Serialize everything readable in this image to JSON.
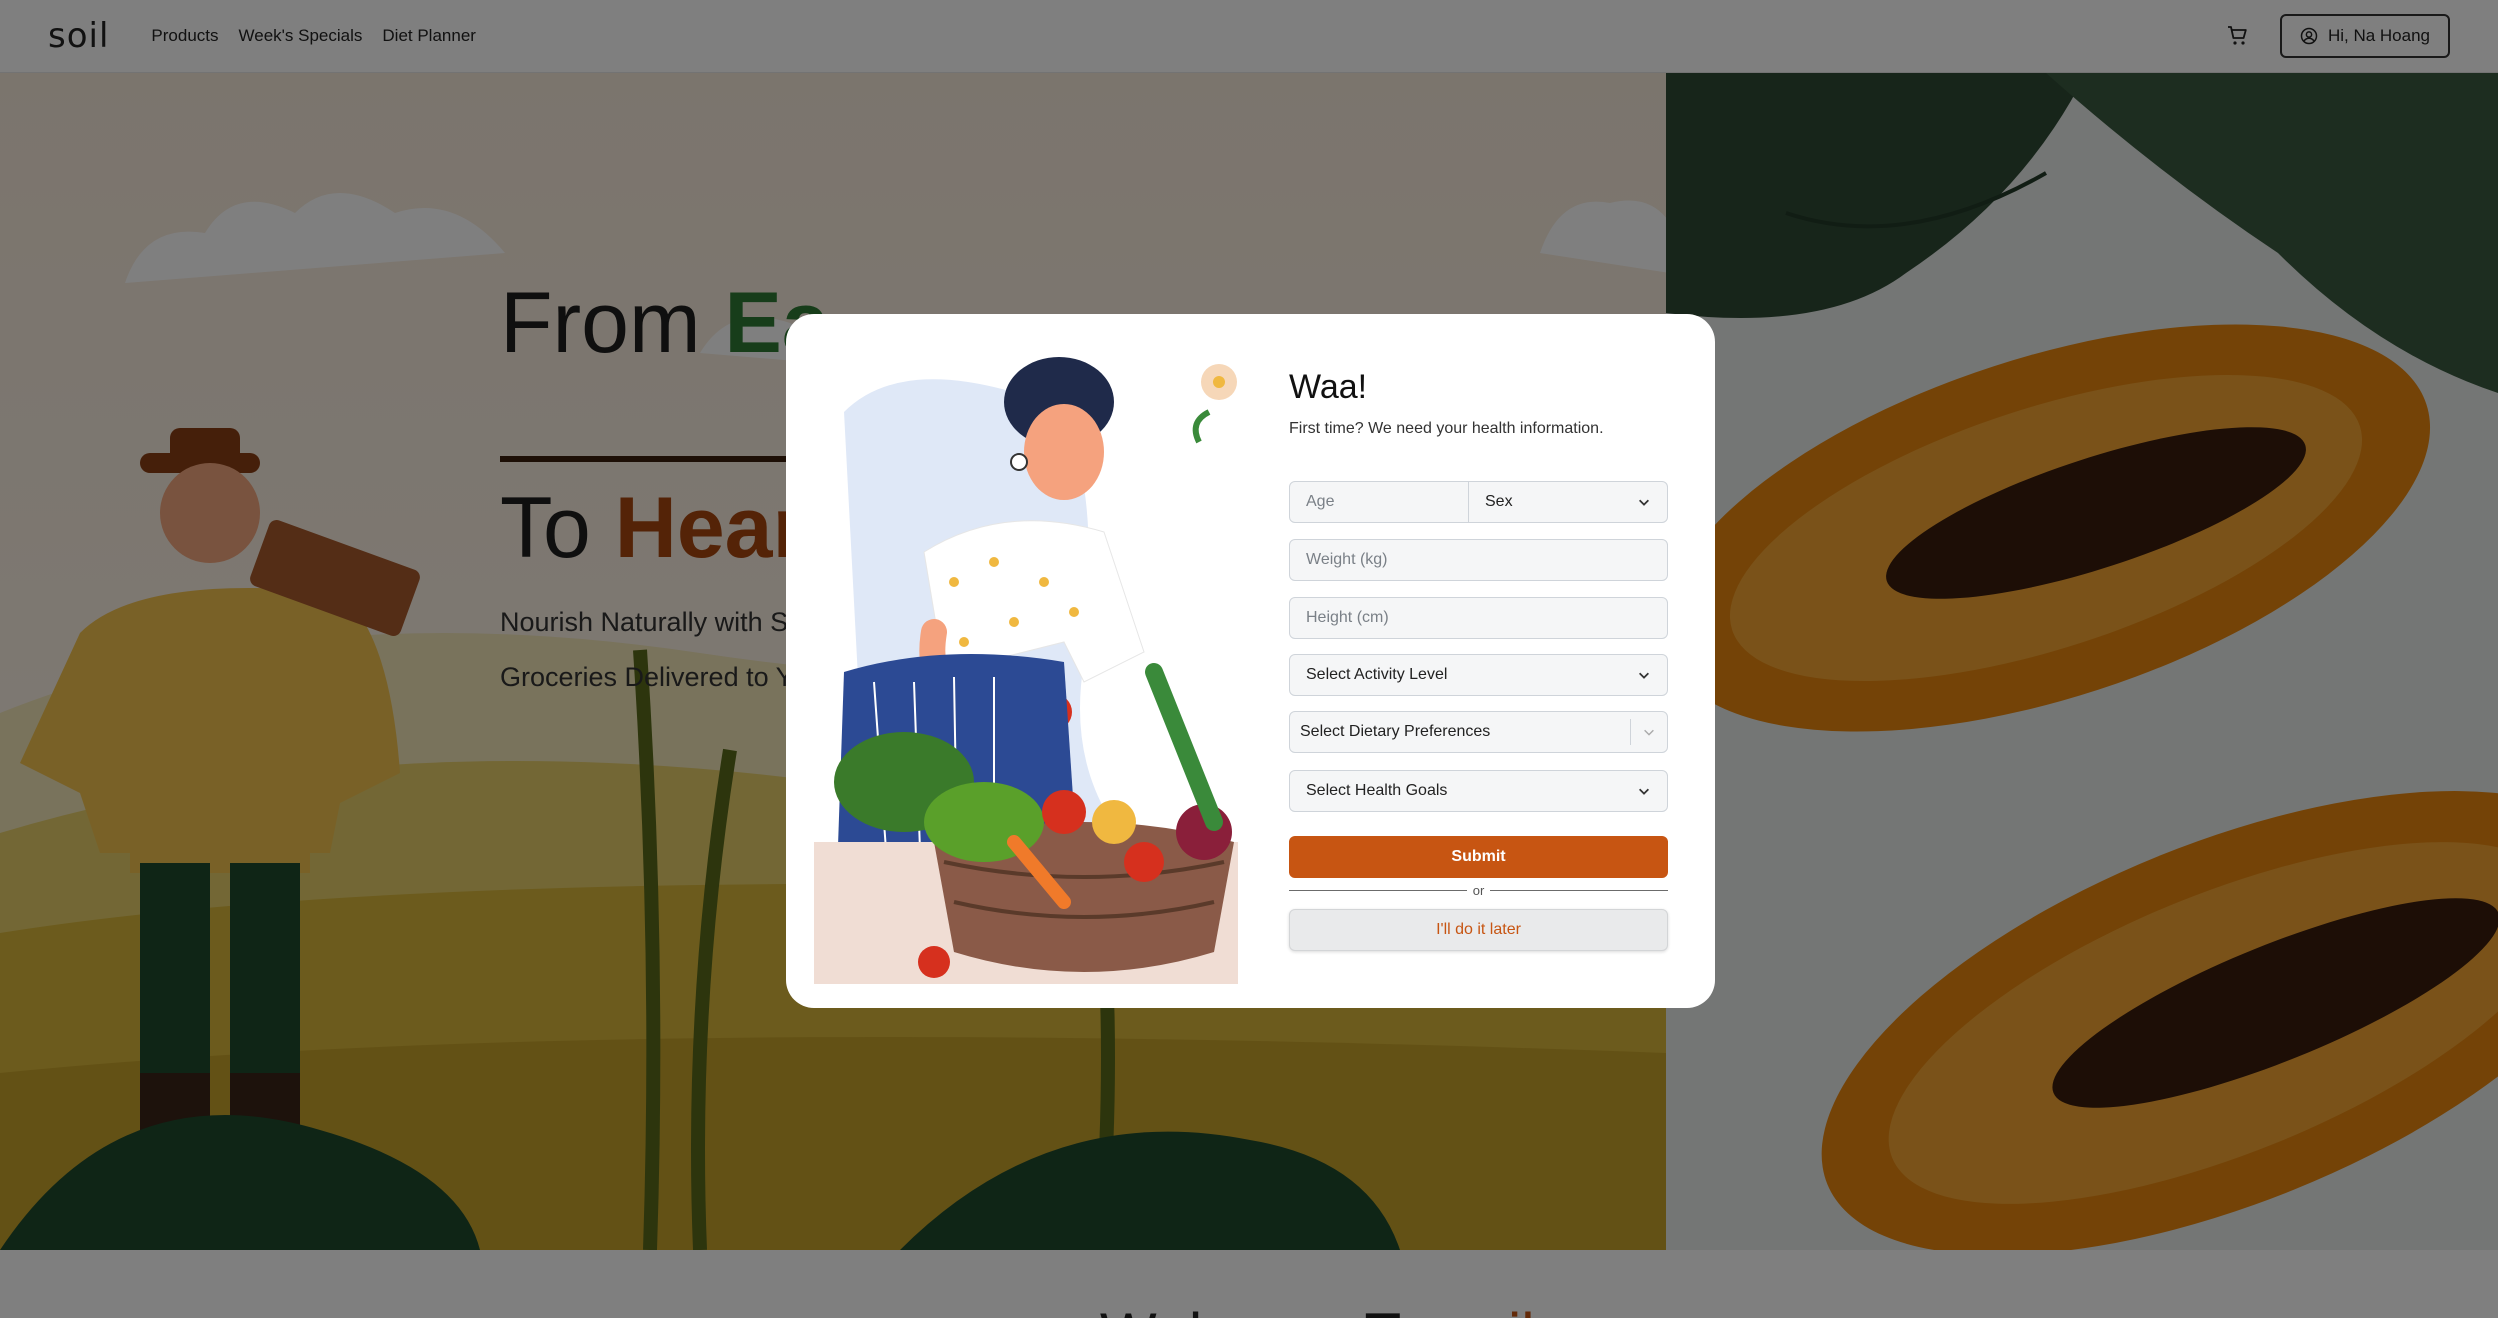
{
  "nav": {
    "brand": "soil",
    "links": [
      "Products",
      "Week's Specials",
      "Diet Planner"
    ],
    "user_button": "Hi, Na Hoang"
  },
  "hero": {
    "title_line1_prefix": "From ",
    "title_line1_accent": "Ea",
    "title_line2_prefix": "To ",
    "title_line2_accent": "Hear",
    "subtitle_line1": "Nourish Naturally with S",
    "subtitle_line2": "Groceries Delivered to Y"
  },
  "welcome": {
    "prefix": "Welcome To ",
    "accent": "soil"
  },
  "modal": {
    "title": "Waa!",
    "subtitle": "First time? We need your health information.",
    "age_placeholder": "Age",
    "sex_label": "Sex",
    "weight_placeholder": "Weight (kg)",
    "height_placeholder": "Height (cm)",
    "activity_label": "Select Activity Level",
    "dietary_label": "Select Dietary Preferences",
    "goals_label": "Select Health Goals",
    "submit_label": "Submit",
    "or_label": "or",
    "later_label": "I'll do it later"
  },
  "colors": {
    "accent": "#c75512",
    "green": "#2f7a35",
    "overlay": "rgba(0,0,0,0.5)"
  },
  "icons": [
    "cart-icon",
    "user-circle-icon",
    "chevron-down-icon"
  ]
}
